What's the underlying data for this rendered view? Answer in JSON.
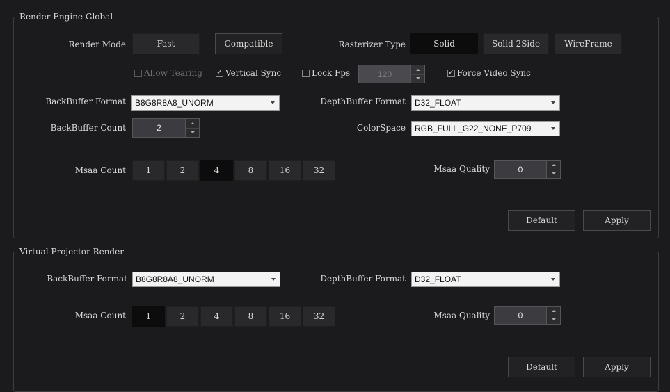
{
  "global": {
    "title": "Render Engine Global",
    "render_mode": {
      "label": "Render Mode",
      "options": [
        "Fast",
        "Compatible"
      ],
      "selected": "Compatible"
    },
    "rasterizer": {
      "label": "Rasterizer Type",
      "options": [
        "Solid",
        "Solid 2Side",
        "WireFrame"
      ],
      "selected": "Solid"
    },
    "allow_tearing": {
      "label": "Allow Tearing",
      "checked": false,
      "enabled": false
    },
    "vertical_sync": {
      "label": "Vertical Sync",
      "checked": true
    },
    "lock_fps": {
      "label": "Lock Fps",
      "checked": false,
      "value": "120"
    },
    "force_video_sync": {
      "label": "Force Video Sync",
      "checked": true
    },
    "backbuffer_format": {
      "label": "BackBuffer Format",
      "value": "B8G8R8A8_UNORM"
    },
    "depthbuffer_format": {
      "label": "DepthBuffer Format",
      "value": "D32_FLOAT"
    },
    "backbuffer_count": {
      "label": "BackBuffer Count",
      "value": "2"
    },
    "colorspace": {
      "label": "ColorSpace",
      "value": "RGB_FULL_G22_NONE_P709"
    },
    "msaa_count": {
      "label": "Msaa Count",
      "options": [
        "1",
        "2",
        "4",
        "8",
        "16",
        "32"
      ],
      "selected": "4"
    },
    "msaa_quality": {
      "label": "Msaa Quality",
      "value": "0"
    },
    "default_label": "Default",
    "apply_label": "Apply"
  },
  "projector": {
    "title": "Virtual Projector Render",
    "backbuffer_format": {
      "label": "BackBuffer Format",
      "value": "B8G8R8A8_UNORM"
    },
    "depthbuffer_format": {
      "label": "DepthBuffer Format",
      "value": "D32_FLOAT"
    },
    "msaa_count": {
      "label": "Msaa Count",
      "options": [
        "1",
        "2",
        "4",
        "8",
        "16",
        "32"
      ],
      "selected": "1"
    },
    "msaa_quality": {
      "label": "Msaa Quality",
      "value": "0"
    },
    "default_label": "Default",
    "apply_label": "Apply"
  },
  "icons": {
    "check": "checkmark-icon",
    "dropdown": "chevron-down-icon",
    "spin_up": "arrow-up-icon",
    "spin_down": "arrow-down-icon"
  },
  "colors": {
    "background": "#1b1b1d",
    "button": "#29292c",
    "selected": "#0c0c0d",
    "combo_bg": "#f3f3f3",
    "spin_bg": "#3c3c40"
  }
}
